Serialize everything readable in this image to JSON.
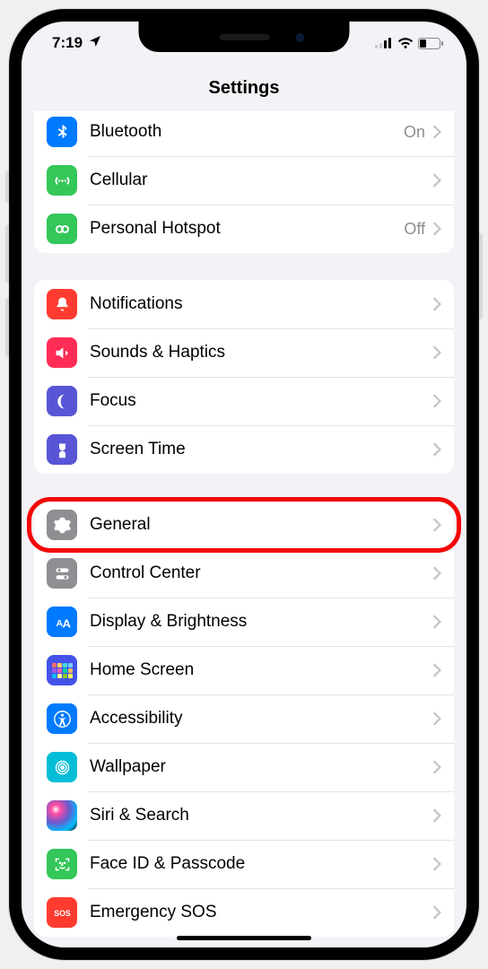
{
  "status": {
    "time": "7:19"
  },
  "header": {
    "title": "Settings"
  },
  "groups": [
    {
      "rows": [
        {
          "label": "Bluetooth",
          "value": "On"
        },
        {
          "label": "Cellular",
          "value": ""
        },
        {
          "label": "Personal Hotspot",
          "value": "Off"
        }
      ]
    },
    {
      "rows": [
        {
          "label": "Notifications"
        },
        {
          "label": "Sounds & Haptics"
        },
        {
          "label": "Focus"
        },
        {
          "label": "Screen Time"
        }
      ]
    },
    {
      "rows": [
        {
          "label": "General"
        },
        {
          "label": "Control Center"
        },
        {
          "label": "Display & Brightness"
        },
        {
          "label": "Home Screen"
        },
        {
          "label": "Accessibility"
        },
        {
          "label": "Wallpaper"
        },
        {
          "label": "Siri & Search"
        },
        {
          "label": "Face ID & Passcode"
        },
        {
          "label": "Emergency SOS"
        }
      ]
    }
  ]
}
